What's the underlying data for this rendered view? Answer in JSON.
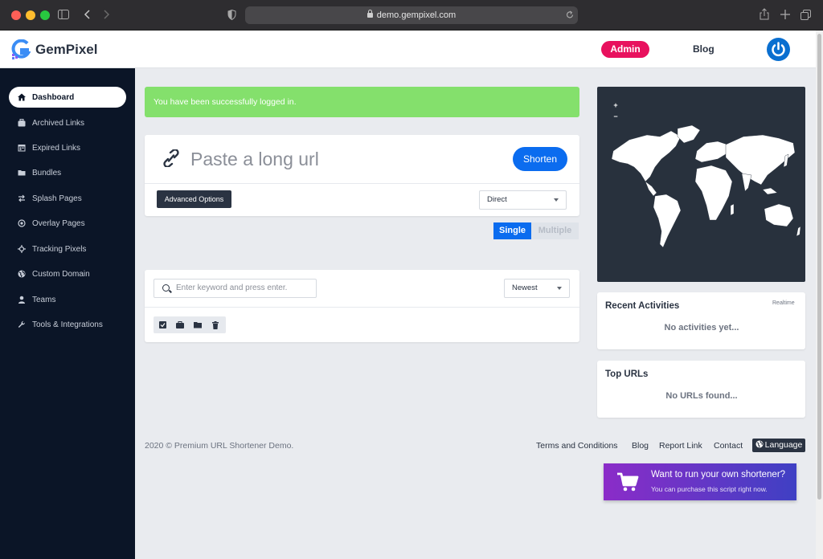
{
  "browser": {
    "url": "demo.gempixel.com"
  },
  "brand": {
    "name": "GemPixel",
    "accent": "#0b6cef",
    "sidebar_bg": "#0b1527",
    "admin_color": "#e8115e"
  },
  "header": {
    "admin_label": "Admin",
    "blog_label": "Blog",
    "power_icon": "power-icon"
  },
  "sidebar": {
    "items": [
      {
        "label": "Dashboard",
        "icon": "home-icon",
        "active": true
      },
      {
        "label": "Archived Links",
        "icon": "briefcase-icon"
      },
      {
        "label": "Expired Links",
        "icon": "calendar-icon"
      },
      {
        "label": "Bundles",
        "icon": "folder-icon"
      },
      {
        "label": "Splash Pages",
        "icon": "swap-icon"
      },
      {
        "label": "Overlay Pages",
        "icon": "target-icon"
      },
      {
        "label": "Tracking Pixels",
        "icon": "crosshair-icon"
      },
      {
        "label": "Custom Domain",
        "icon": "globe-icon"
      },
      {
        "label": "Teams",
        "icon": "user-icon"
      },
      {
        "label": "Tools & Integrations",
        "icon": "wrench-icon"
      }
    ]
  },
  "alert": {
    "message": "You have been successfully logged in."
  },
  "shortener": {
    "placeholder": "Paste a long url",
    "shorten_label": "Shorten",
    "advanced_label": "Advanced Options",
    "redirect_selected": "Direct",
    "single_label": "Single",
    "multiple_label": "Multiple"
  },
  "links": {
    "search_placeholder": "Enter keyword and press enter.",
    "sort_selected": "Newest"
  },
  "map": {
    "zoom_in": "+",
    "zoom_out": "−"
  },
  "recent": {
    "title": "Recent Activities",
    "badge": "Realtime",
    "empty": "No activities yet..."
  },
  "top_urls": {
    "title": "Top URLs",
    "empty": "No URLs found..."
  },
  "footer": {
    "copyright": "2020 © Premium URL Shortener Demo.",
    "links": [
      "Terms and Conditions",
      "Blog",
      "Report Link",
      "Contact"
    ],
    "language_label": "Language"
  },
  "promo": {
    "title": "Want to run your own shortener?",
    "subtitle": "You can purchase this script right now."
  }
}
